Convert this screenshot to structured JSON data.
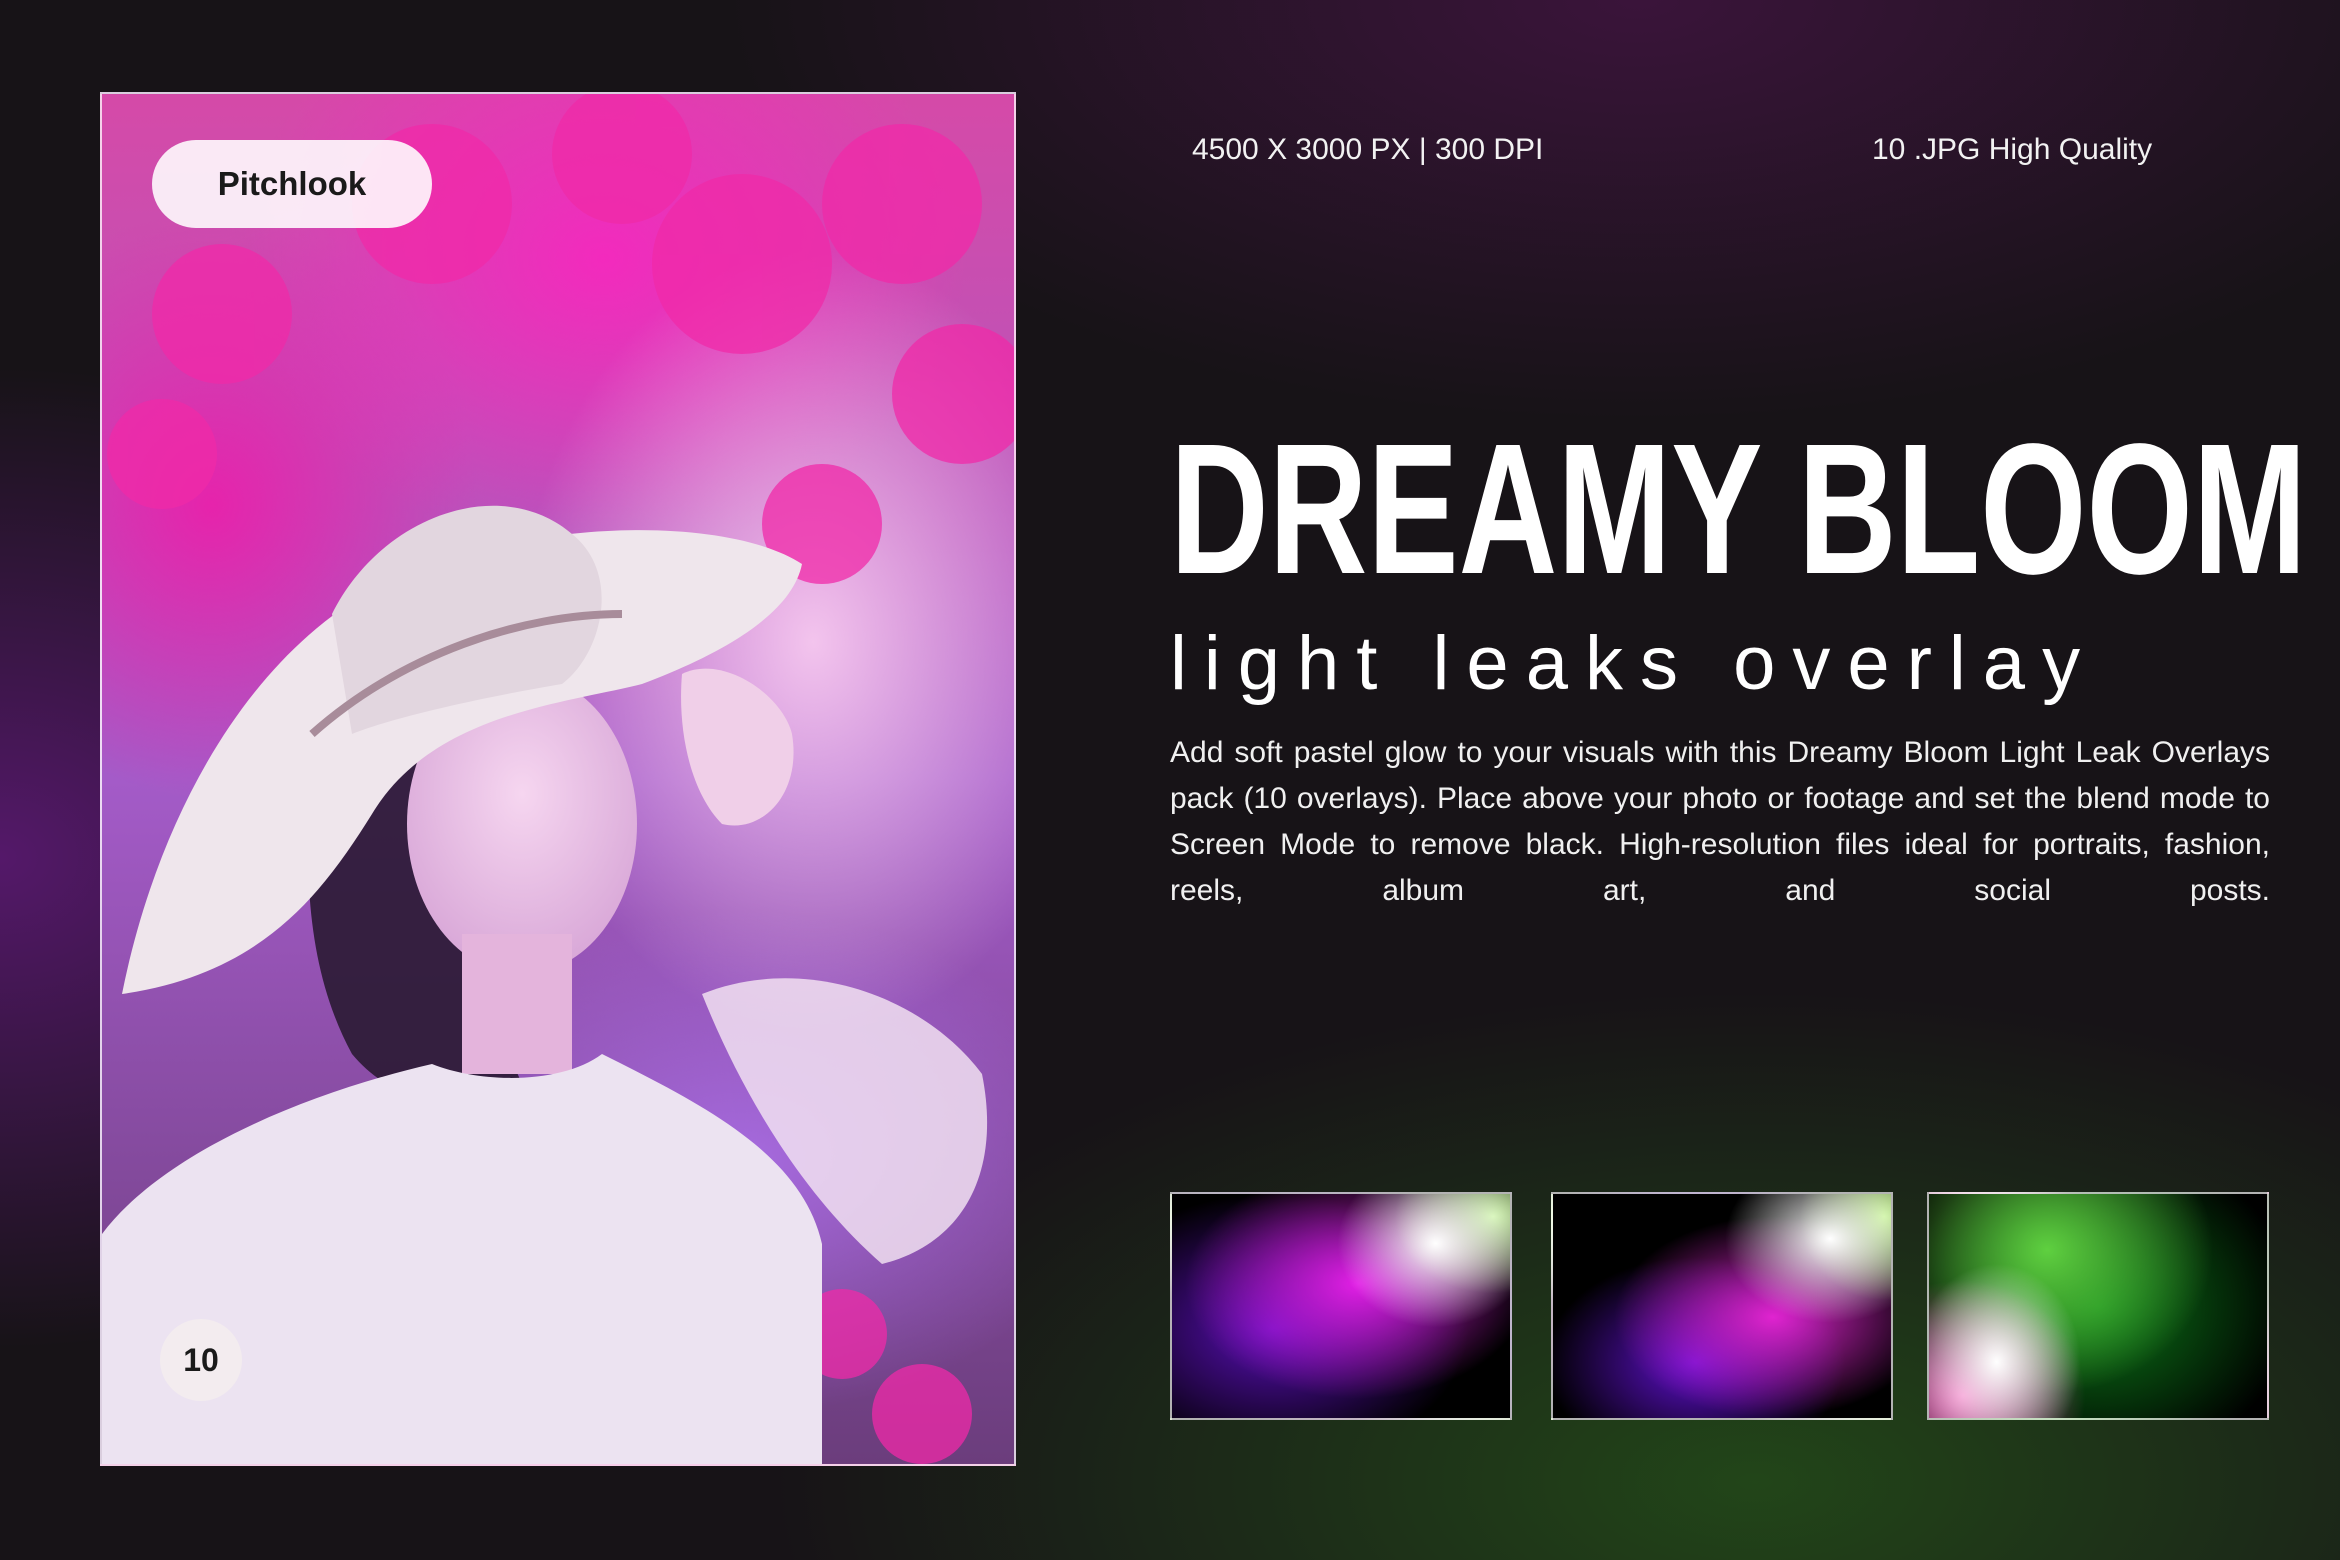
{
  "brand": "Pitchlook",
  "overlay_count_badge": "10",
  "specs": {
    "resolution": "4500 X 3000 PX  |  300 DPI",
    "format": "10  .JPG  High Quality"
  },
  "title": "DREAMY BLOOM",
  "subtitle": "light leaks overlay",
  "description": "Add soft pastel glow to your visuals with this Dreamy Bloom Light Leak Overlays pack (10 overlays). Place above your photo or footage and set the blend mode to Screen Mode to remove black. High-resolution files ideal for portraits, fashion, reels, album art, and social posts.",
  "colors": {
    "background": "#171317",
    "accent_magenta": "#e21fe6",
    "accent_violet": "#5a0fb8",
    "accent_green": "#5fd040"
  }
}
